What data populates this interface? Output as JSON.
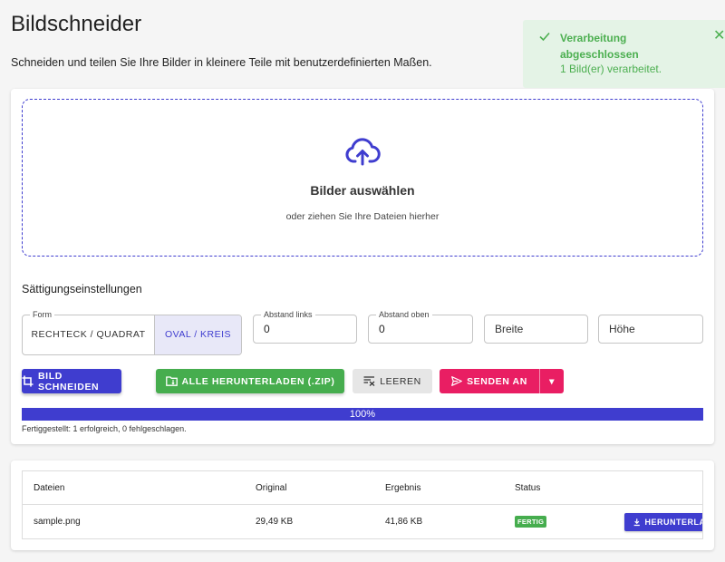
{
  "page": {
    "title": "Bildschneider",
    "subtitle": "Schneiden und teilen Sie Ihre Bilder in kleinere Teile mit benutzerdefinierten Maßen."
  },
  "toast": {
    "title": "Verarbeitung abgeschlossen",
    "message": "1 Bild(er) verarbeitet.",
    "close": "✕",
    "color": "#4caf50",
    "icons": [
      "check-icon",
      "close-icon"
    ]
  },
  "dropzone": {
    "title": "Bilder auswählen",
    "subtitle": "oder ziehen Sie Ihre Dateien hierher",
    "icon": "cloud-upload-icon"
  },
  "settings": {
    "title": "Sättigungseinstellungen",
    "form_legend": "Form",
    "shape_options": [
      "RECHTECK / QUADRAT",
      "OVAL / KREIS"
    ],
    "shape_selected": "OVAL / KREIS",
    "margin_left_label": "Abstand links",
    "margin_left_value": "0",
    "margin_top_label": "Abstand oben",
    "margin_top_value": "0",
    "width_placeholder": "Breite",
    "height_placeholder": "Höhe"
  },
  "actions": {
    "crop": "BILD SCHNEIDEN",
    "download_all": "ALLE HERUNTERLADEN (.ZIP)",
    "clear": "LEEREN",
    "send_to": "SENDEN AN",
    "send_dropdown": "▾"
  },
  "progress": {
    "value": 1.0,
    "label": "100%",
    "status": "Fertiggestellt: 1 erfolgreich, 0 fehlgeschlagen."
  },
  "table": {
    "headers": [
      "Dateien",
      "Original",
      "Ergebnis",
      "Status",
      ""
    ],
    "rows": [
      {
        "file": "sample.png",
        "original": "29,49 KB",
        "result": "41,86 KB",
        "status": "FERTIG",
        "action": "HERUNTERLADEN"
      }
    ]
  },
  "colors": {
    "primary": "#3f3dcf",
    "success": "#46ad4e",
    "accent": "#e91e63",
    "toast_bg": "#e4f3e6"
  }
}
